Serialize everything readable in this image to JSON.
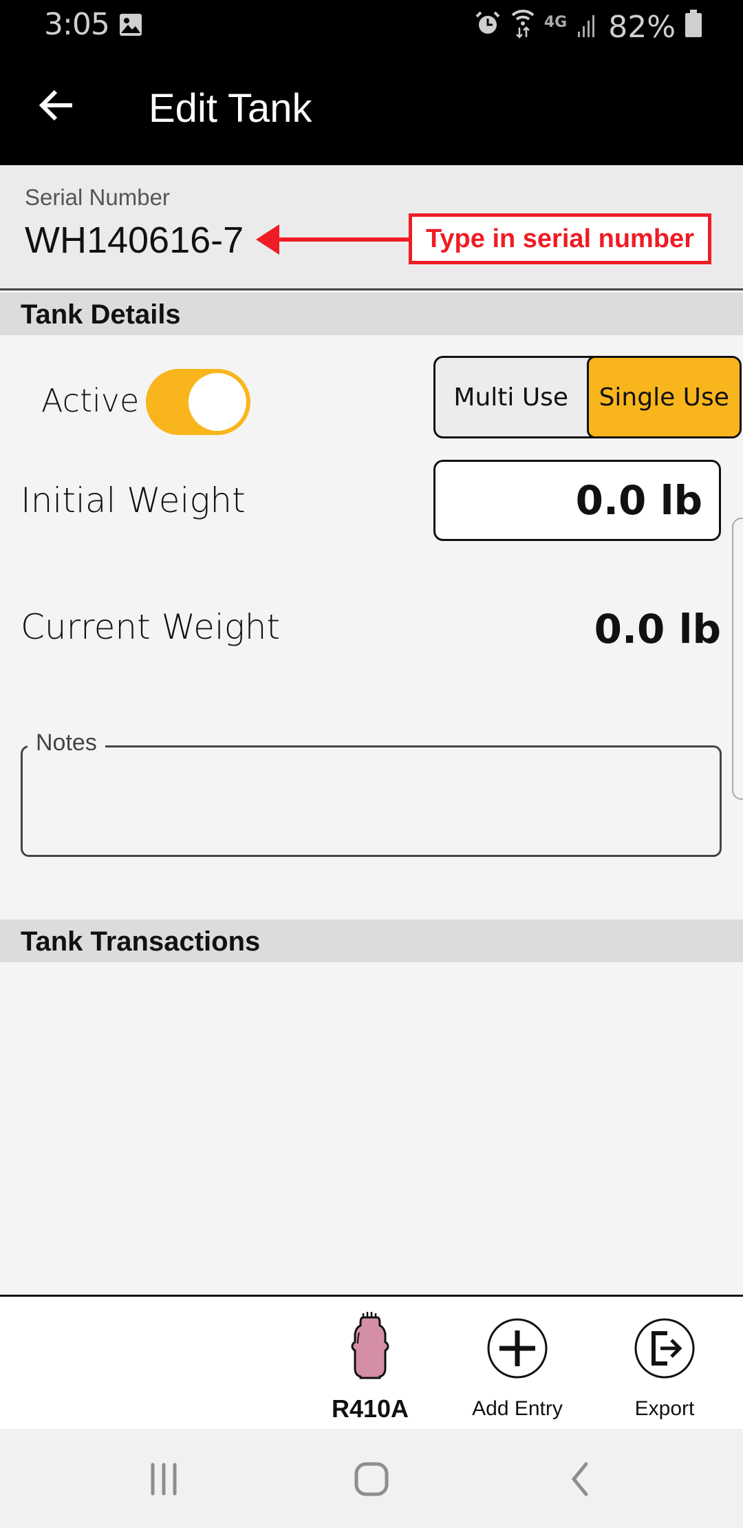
{
  "status_bar": {
    "time": "3:05",
    "battery": "82%",
    "icons": [
      "image-icon",
      "alarm-icon",
      "wifi-icon",
      "4g-lte-icon",
      "signal-icon",
      "battery-icon"
    ]
  },
  "header": {
    "title": "Edit Tank",
    "back_icon": "arrow-left-icon"
  },
  "serial": {
    "label": "Serial Number",
    "value": "WH140616-7"
  },
  "annotation": {
    "text": "Type in serial number",
    "color": "#ee1c24"
  },
  "tank_details": {
    "section_title": "Tank Details",
    "active_label": "Active",
    "active": true,
    "use_options": [
      "Multi Use",
      "Single Use"
    ],
    "selected_use": "Single Use",
    "initial_weight_label": "Initial Weight",
    "initial_weight_value": "0.0 lb",
    "current_weight_label": "Current Weight",
    "current_weight_value": "0.0 lb",
    "notes_label": "Notes",
    "notes_value": ""
  },
  "transactions": {
    "section_title": "Tank Transactions",
    "items": []
  },
  "bottom_bar": {
    "refrigerant": "R410A",
    "add_entry": "Add Entry",
    "export": "Export"
  },
  "colors": {
    "accent": "#f9b51c",
    "tank_pink": "#d48fa6",
    "header_bg": "#000000"
  }
}
